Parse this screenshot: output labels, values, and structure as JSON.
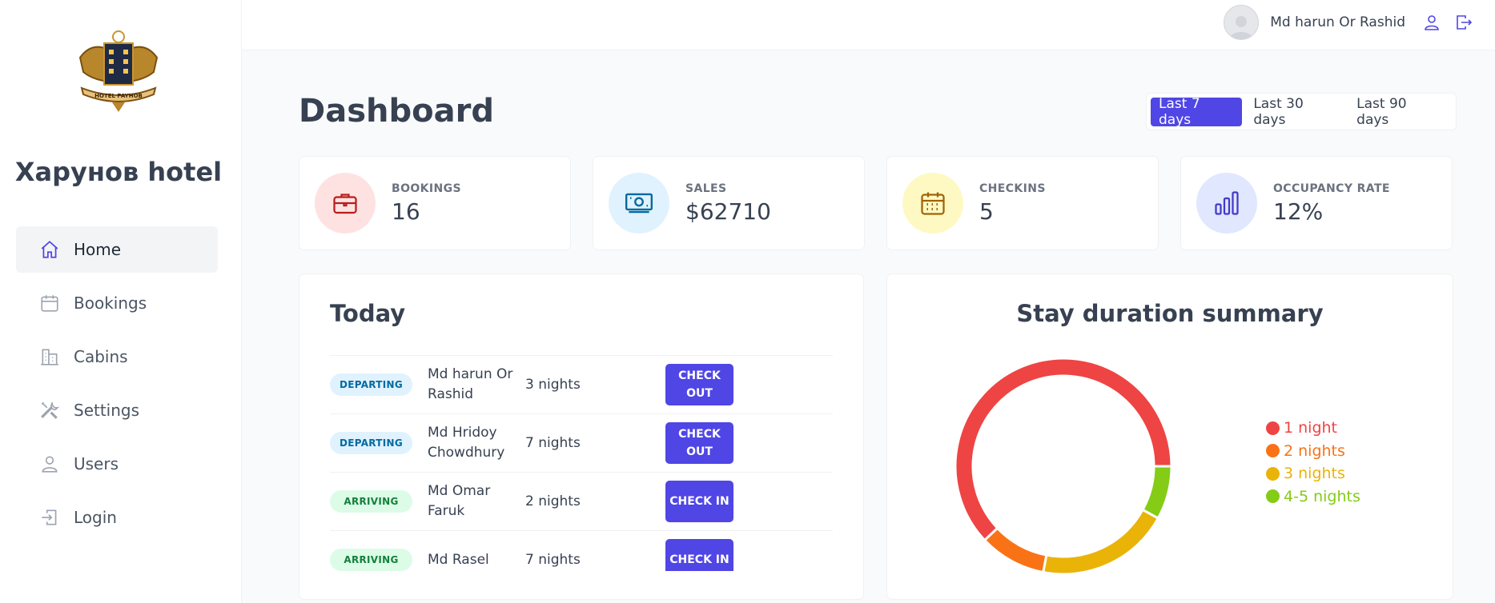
{
  "sidebar": {
    "brand": "Харунов hotel",
    "logo_text": "HOTEL PAYHOB",
    "items": [
      {
        "label": "Home",
        "icon": "home-icon",
        "active": true
      },
      {
        "label": "Bookings",
        "icon": "calendar-icon",
        "active": false
      },
      {
        "label": "Cabins",
        "icon": "building-icon",
        "active": false
      },
      {
        "label": "Settings",
        "icon": "wrench-screwdriver-icon",
        "active": false
      },
      {
        "label": "Users",
        "icon": "user-icon",
        "active": false
      },
      {
        "label": "Login",
        "icon": "login-icon",
        "active": false
      }
    ]
  },
  "header": {
    "user_name": "Md harun Or Rashid",
    "account_icon": "user-icon",
    "logout_icon": "logout-icon"
  },
  "page": {
    "title": "Dashboard",
    "filters": [
      "Last 7 days",
      "Last 30 days",
      "Last 90 days"
    ],
    "active_filter": "Last 7 days"
  },
  "stats": [
    {
      "label": "BOOKINGS",
      "value": "16",
      "icon": "briefcase-icon",
      "color": "#b91c1c",
      "bg": "#fee2e2"
    },
    {
      "label": "SALES",
      "value": "$62710",
      "icon": "banknotes-icon",
      "color": "#0369a1",
      "bg": "#e0f2fe"
    },
    {
      "label": "CHECKINS",
      "value": "5",
      "icon": "calendar-days-icon",
      "color": "#a16207",
      "bg": "#fef9c3"
    },
    {
      "label": "OCCUPANCY RATE",
      "value": "12%",
      "icon": "chart-bar-icon",
      "color": "#4338ca",
      "bg": "#e0e7ff"
    }
  ],
  "today": {
    "title": "Today",
    "rows": [
      {
        "status": "DEPARTING",
        "guest": "Md harun Or Rashid",
        "nights": "3 nights",
        "action": "CHECK OUT"
      },
      {
        "status": "DEPARTING",
        "guest": "Md Hridoy Chowdhury",
        "nights": "7 nights",
        "action": "CHECK OUT"
      },
      {
        "status": "ARRIVING",
        "guest": "Md Omar Faruk",
        "nights": "2 nights",
        "action": "CHECK IN"
      },
      {
        "status": "ARRIVING",
        "guest": "Md Rasel",
        "nights": "7 nights",
        "action": "CHECK IN"
      }
    ]
  },
  "chart_data": {
    "type": "pie",
    "title": "Stay duration summary",
    "categories": [
      "1 night",
      "2 nights",
      "3 nights",
      "4-5 nights"
    ],
    "values": [
      62,
      10,
      20,
      8
    ],
    "colors": [
      "#ef4444",
      "#f97316",
      "#eab308",
      "#84cc16"
    ],
    "legend": "right"
  }
}
